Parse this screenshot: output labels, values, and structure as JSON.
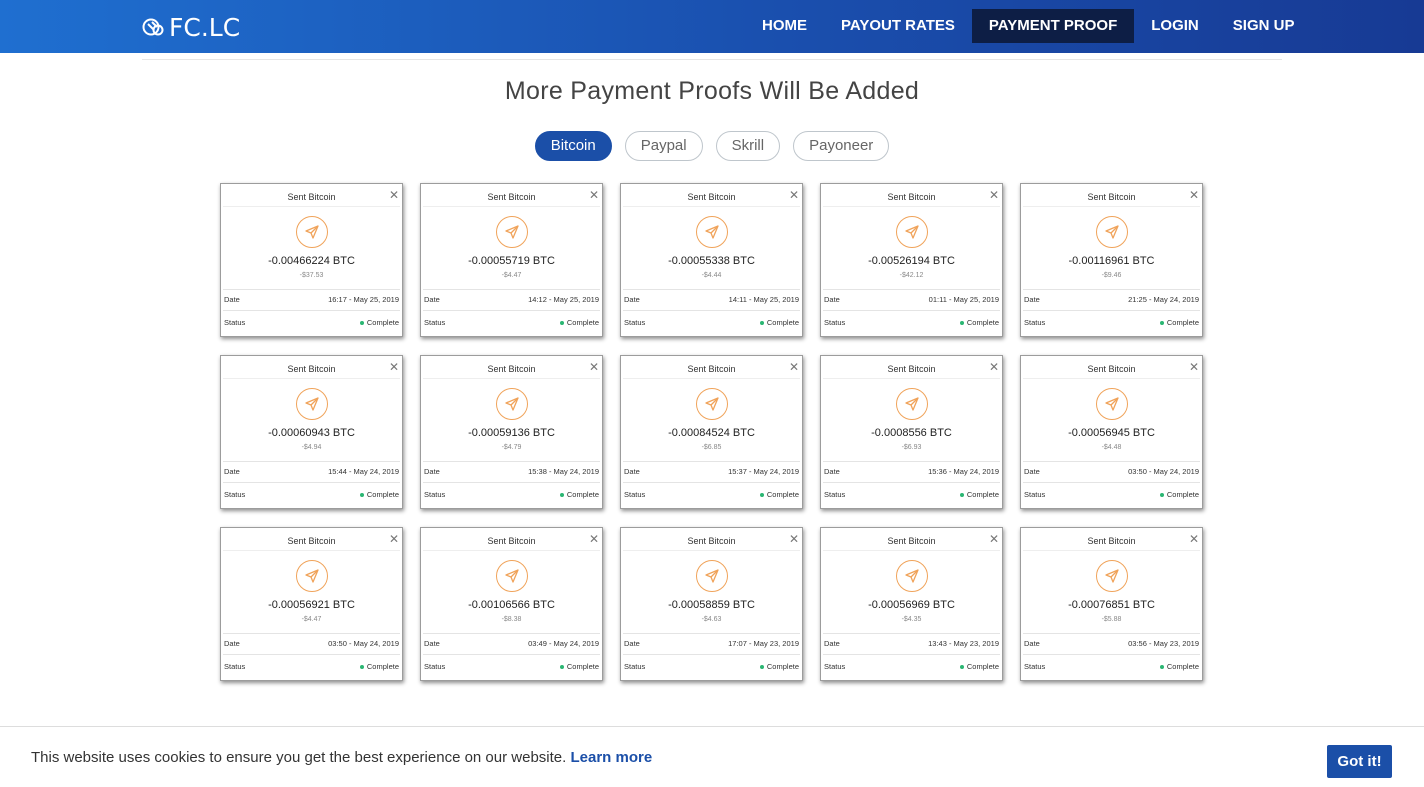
{
  "brand": {
    "logo_text": "FC.LC"
  },
  "nav": {
    "items": [
      {
        "label": "HOME",
        "active": false
      },
      {
        "label": "PAYOUT RATES",
        "active": false
      },
      {
        "label": "PAYMENT PROOF",
        "active": true
      },
      {
        "label": "LOGIN",
        "active": false
      },
      {
        "label": "SIGN UP",
        "active": false
      }
    ]
  },
  "page": {
    "heading": "More Payment Proofs Will Be Added"
  },
  "tabs": [
    {
      "label": "Bitcoin",
      "active": true
    },
    {
      "label": "Paypal",
      "active": false
    },
    {
      "label": "Skrill",
      "active": false
    },
    {
      "label": "Payoneer",
      "active": false
    }
  ],
  "card_labels": {
    "title": "Sent Bitcoin",
    "date_label": "Date",
    "status_label": "Status",
    "status_value": "Complete"
  },
  "proofs": [
    {
      "amount": "-0.00466224 BTC",
      "usd": "-$37.53",
      "date": "16:17 - May 25, 2019"
    },
    {
      "amount": "-0.00055719 BTC",
      "usd": "-$4.47",
      "date": "14:12 - May 25, 2019"
    },
    {
      "amount": "-0.00055338 BTC",
      "usd": "-$4.44",
      "date": "14:11 - May 25, 2019"
    },
    {
      "amount": "-0.00526194 BTC",
      "usd": "-$42.12",
      "date": "01:11 - May 25, 2019"
    },
    {
      "amount": "-0.00116961 BTC",
      "usd": "-$9.46",
      "date": "21:25 - May 24, 2019"
    },
    {
      "amount": "-0.00060943 BTC",
      "usd": "-$4.94",
      "date": "15:44 - May 24, 2019"
    },
    {
      "amount": "-0.00059136 BTC",
      "usd": "-$4.79",
      "date": "15:38 - May 24, 2019"
    },
    {
      "amount": "-0.00084524 BTC",
      "usd": "-$6.85",
      "date": "15:37 - May 24, 2019"
    },
    {
      "amount": "-0.0008556 BTC",
      "usd": "-$6.93",
      "date": "15:36 - May 24, 2019"
    },
    {
      "amount": "-0.00056945 BTC",
      "usd": "-$4.48",
      "date": "03:50 - May 24, 2019"
    },
    {
      "amount": "-0.00056921 BTC",
      "usd": "-$4.47",
      "date": "03:50 - May 24, 2019"
    },
    {
      "amount": "-0.00106566 BTC",
      "usd": "-$8.38",
      "date": "03:49 - May 24, 2019"
    },
    {
      "amount": "-0.00058859 BTC",
      "usd": "-$4.63",
      "date": "17:07 - May 23, 2019"
    },
    {
      "amount": "-0.00056969 BTC",
      "usd": "-$4.35",
      "date": "13:43 - May 23, 2019"
    },
    {
      "amount": "-0.00076851 BTC",
      "usd": "-$5.88",
      "date": "03:56 - May 23, 2019"
    }
  ],
  "cookie": {
    "text": "This website uses cookies to ensure you get the best experience on our website.",
    "link_label": "Learn more",
    "button_label": "Got it!"
  },
  "colors": {
    "nav_gradient_start": "#1f6fd0",
    "nav_gradient_end": "#173a94",
    "nav_active": "#0d1e45",
    "accent": "#1b4fa8",
    "icon_orange": "#f0a35a",
    "status_green": "#2bb673"
  },
  "icons": {
    "card_icon": "send-arrow-icon",
    "close": "close-icon",
    "logo": "link-icon"
  }
}
